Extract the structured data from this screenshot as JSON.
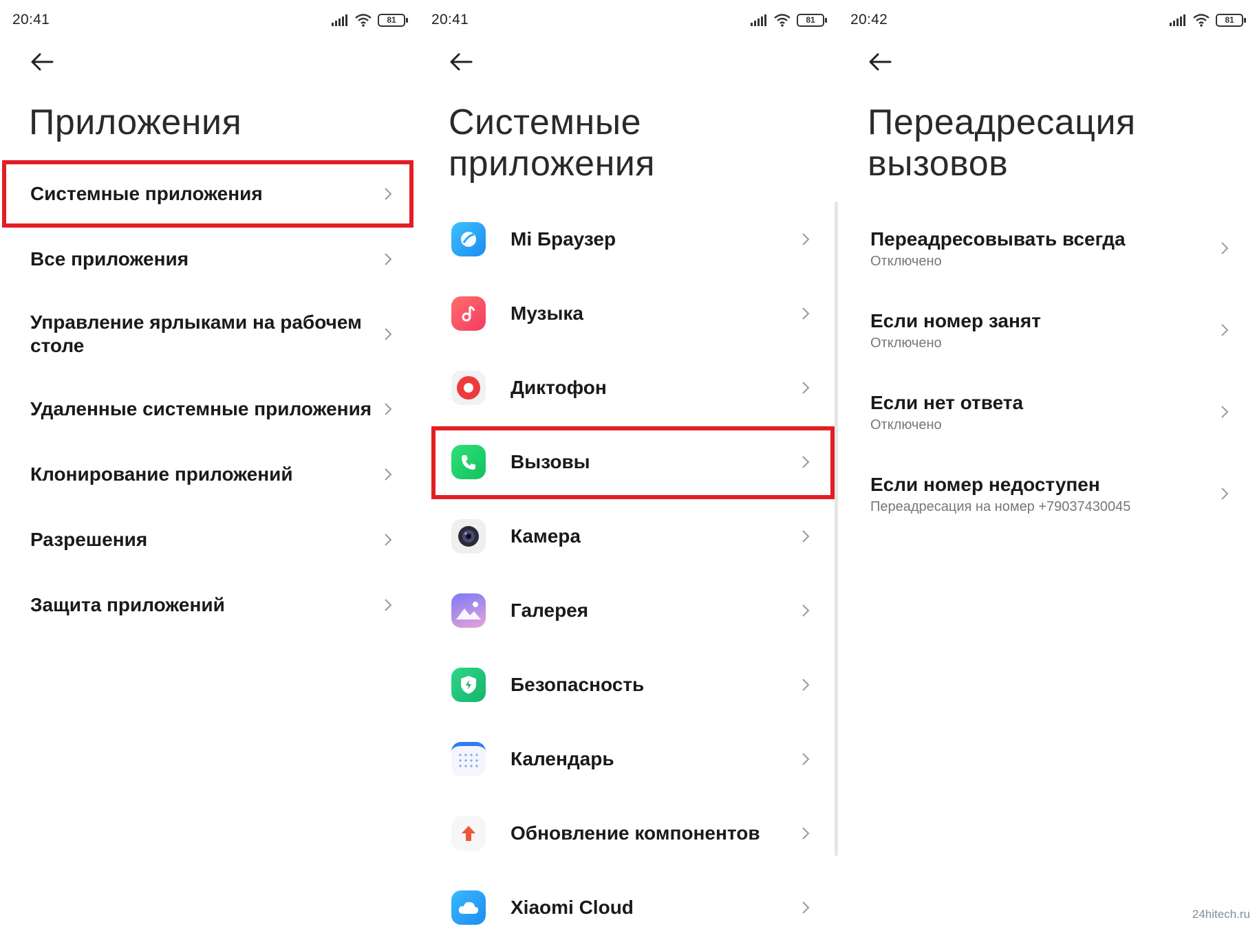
{
  "watermark": "24hitech.ru",
  "colors": {
    "highlight": "#e31e24",
    "text": "#1a1a1a",
    "subtext": "#777777"
  },
  "panels": [
    {
      "time": "20:41",
      "battery": "81",
      "title": "Приложения",
      "items": [
        {
          "label": "Системные приложения",
          "highlighted": true
        },
        {
          "label": "Все приложения"
        },
        {
          "label": "Управление ярлыками на рабочем столе"
        },
        {
          "label": "Удаленные системные приложения"
        },
        {
          "label": "Клонирование приложений"
        },
        {
          "label": "Разрешения"
        },
        {
          "label": "Защита приложений"
        }
      ]
    },
    {
      "time": "20:41",
      "battery": "81",
      "title_line1": "Системные",
      "title_line2": "приложения",
      "items": [
        {
          "label": "Mi Браузер",
          "icon": "browser-icon"
        },
        {
          "label": "Музыка",
          "icon": "music-icon"
        },
        {
          "label": "Диктофон",
          "icon": "recorder-icon"
        },
        {
          "label": "Вызовы",
          "icon": "phone-icon",
          "highlighted": true
        },
        {
          "label": "Камера",
          "icon": "camera-icon"
        },
        {
          "label": "Галерея",
          "icon": "gallery-icon"
        },
        {
          "label": "Безопасность",
          "icon": "security-icon"
        },
        {
          "label": "Календарь",
          "icon": "calendar-icon"
        },
        {
          "label": "Обновление компонентов",
          "icon": "update-icon"
        },
        {
          "label": "Xiaomi Cloud",
          "icon": "cloud-icon"
        }
      ]
    },
    {
      "time": "20:42",
      "battery": "81",
      "title_line1": "Переадресация",
      "title_line2": "вызовов",
      "items": [
        {
          "label": "Переадресовывать всегда",
          "sub": "Отключено"
        },
        {
          "label": "Если номер занят",
          "sub": "Отключено"
        },
        {
          "label": "Если нет ответа",
          "sub": "Отключено"
        },
        {
          "label": "Если номер недоступен",
          "sub": "Переадресация на номер +79037430045"
        }
      ]
    }
  ]
}
